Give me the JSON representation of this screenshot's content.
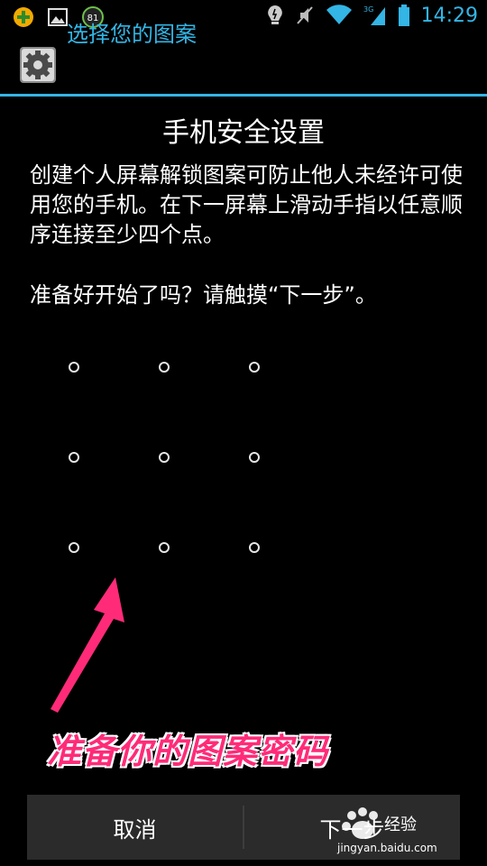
{
  "statusbar": {
    "time": "14:29",
    "badge_number": "81",
    "icons": [
      "app-plus-icon",
      "gallery-icon",
      "battery-badge-icon",
      "lightbulb-icon",
      "mute-icon",
      "wifi-icon",
      "signal-3g-icon",
      "battery-icon"
    ],
    "colors": {
      "accent": "#33b5e5"
    }
  },
  "appbar": {
    "title": "选择您的图案",
    "icon": "gear-icon"
  },
  "content": {
    "title": "手机安全设置",
    "description": "创建个人屏幕解锁图案可防止他人未经许可使用您的手机。在下一屏幕上滑动手指以任意顺序连接至少四个点。",
    "ready": "准备好开始了吗？请触摸“下一步”。"
  },
  "overlay": {
    "caption": "准备你的图案密码",
    "arrow_color": "#ff2b78"
  },
  "buttons": {
    "cancel": "取消",
    "next": "下一步"
  },
  "watermark": {
    "brand": "经验",
    "url": "jingyan.baidu.com"
  }
}
